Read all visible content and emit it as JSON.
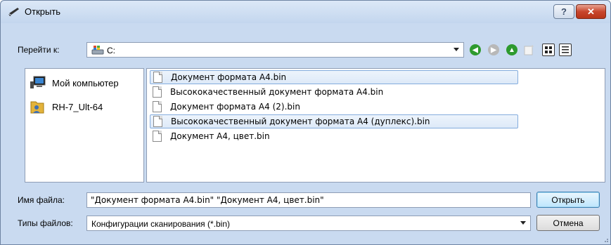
{
  "window": {
    "title": "Открыть",
    "help_glyph": "?",
    "close_glyph": "✕"
  },
  "navbar": {
    "goto_label": "Перейти к:",
    "location_value": "C:"
  },
  "places": [
    {
      "label": "Мой компьютер",
      "icon": "computer-icon"
    },
    {
      "label": "RH-7_Ult-64",
      "icon": "user-folder-icon"
    }
  ],
  "files": [
    {
      "name": "Документ формата A4.bin",
      "selected": true
    },
    {
      "name": "Высококачественный документ формата A4.bin",
      "selected": false
    },
    {
      "name": "Документ формата A4 (2).bin",
      "selected": false
    },
    {
      "name": "Высококачественный документ формата A4 (дуплекс).bin",
      "selected": true
    },
    {
      "name": "Документ A4, цвет.bin",
      "selected": false
    }
  ],
  "filename": {
    "label": "Имя файла:",
    "value": "\"Документ формата A4.bin\"  \"Документ A4, цвет.bin\""
  },
  "filetype": {
    "label": "Типы файлов:",
    "value": "Конфигурации сканирования (*.bin)"
  },
  "buttons": {
    "open": "Открыть",
    "cancel": "Отмена"
  },
  "colors": {
    "nav_green": "#2e9a2e",
    "nav_gray": "#b8b8b8",
    "selection_border": "#84acdd"
  }
}
